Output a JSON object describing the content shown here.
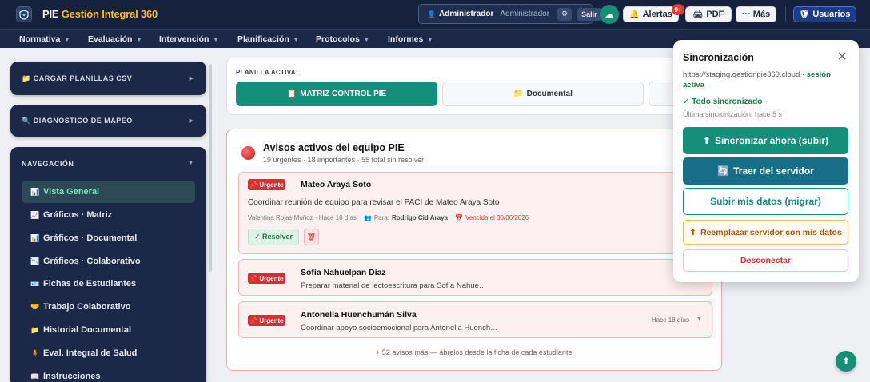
{
  "app": {
    "brand_main": "PIE",
    "brand_sub": "Gestión Integral 360"
  },
  "user": {
    "role": "Administrador",
    "name": "Administrador",
    "settings_label": "⚙",
    "logout_label": "Salir"
  },
  "topbar": {
    "alerts_label": "Alertas",
    "alerts_badge": "9+",
    "pdf_label": "PDF",
    "more_label": "··· Más",
    "users_label": "Usuarios"
  },
  "nav": [
    "Normativa",
    "Evaluación",
    "Intervención",
    "Planificación",
    "Protocolos",
    "Informes"
  ],
  "sidebar": {
    "upload_title": "CARGAR PLANILLAS CSV",
    "diagnostic_title": "DIAGNÓSTICO DE MAPEO",
    "nav_title": "NAVEGACIÓN",
    "items": [
      {
        "icon": "📊",
        "label": "Vista General"
      },
      {
        "icon": "📈",
        "label": "Gráficos · Matriz"
      },
      {
        "icon": "📊",
        "label": "Gráficos · Documental"
      },
      {
        "icon": "📉",
        "label": "Gráficos · Colaborativo"
      },
      {
        "icon": "🪪",
        "label": "Fichas de Estudiantes"
      },
      {
        "icon": "🤝",
        "label": "Trabajo Colaborativo"
      },
      {
        "icon": "📁",
        "label": "Historial Documental"
      },
      {
        "icon": "🧍",
        "label": "Eval. Integral de Salud"
      },
      {
        "icon": "📖",
        "label": "Instrucciones"
      }
    ]
  },
  "planilla": {
    "label": "PLANILLA ACTIVA:",
    "tabs": [
      {
        "icon": "📋",
        "label": "MATRIZ CONTROL PIE"
      },
      {
        "icon": "📁",
        "label": "Documental"
      }
    ]
  },
  "alerts": {
    "title": "Avisos activos del equipo PIE",
    "subtitle": "19 urgentes · 18 importantes · 55 total sin resolver",
    "urgent_label": "Urgente",
    "items": [
      {
        "name": "Mateo Araya Soto",
        "desc": "Coordinar reunión de equipo para revisar el PACI de Mateo Araya Soto",
        "author_time": "Valentina Rojas Muñoz · Hace 18 días",
        "para_label": "Para:",
        "para_name": "Rodrigo Cid Araya",
        "due": "Vencida el 30/06/2026",
        "resolve_label": "✓ Resolver"
      },
      {
        "name": "Sofía Nahuelpan Díaz",
        "desc": "Preparar material de lectoescritura para Sofía Nahue…"
      },
      {
        "name": "Antonella Huenchumán Silva",
        "desc": "Coordinar apoyo socioemocional para Antonella Huench…",
        "time": "Hace 18 días"
      }
    ],
    "more_text": "+ 52 avisos más — ábrelos desde la ficha de cada estudiante."
  },
  "sync": {
    "title": "Sincronización",
    "url": "https://staging.gestionpie360.cloud ·",
    "session": "sesión activa",
    "status": "✓ Todo sincronizado",
    "last": "Última sincronización: hace 5 s",
    "btn_push": "Sincronizar ahora (subir)",
    "btn_pull": "Traer del servidor",
    "btn_migrate": "Subir mis datos (migrar)",
    "btn_replace": "Reemplazar servidor con mis datos",
    "btn_disconnect": "Desconectar"
  }
}
